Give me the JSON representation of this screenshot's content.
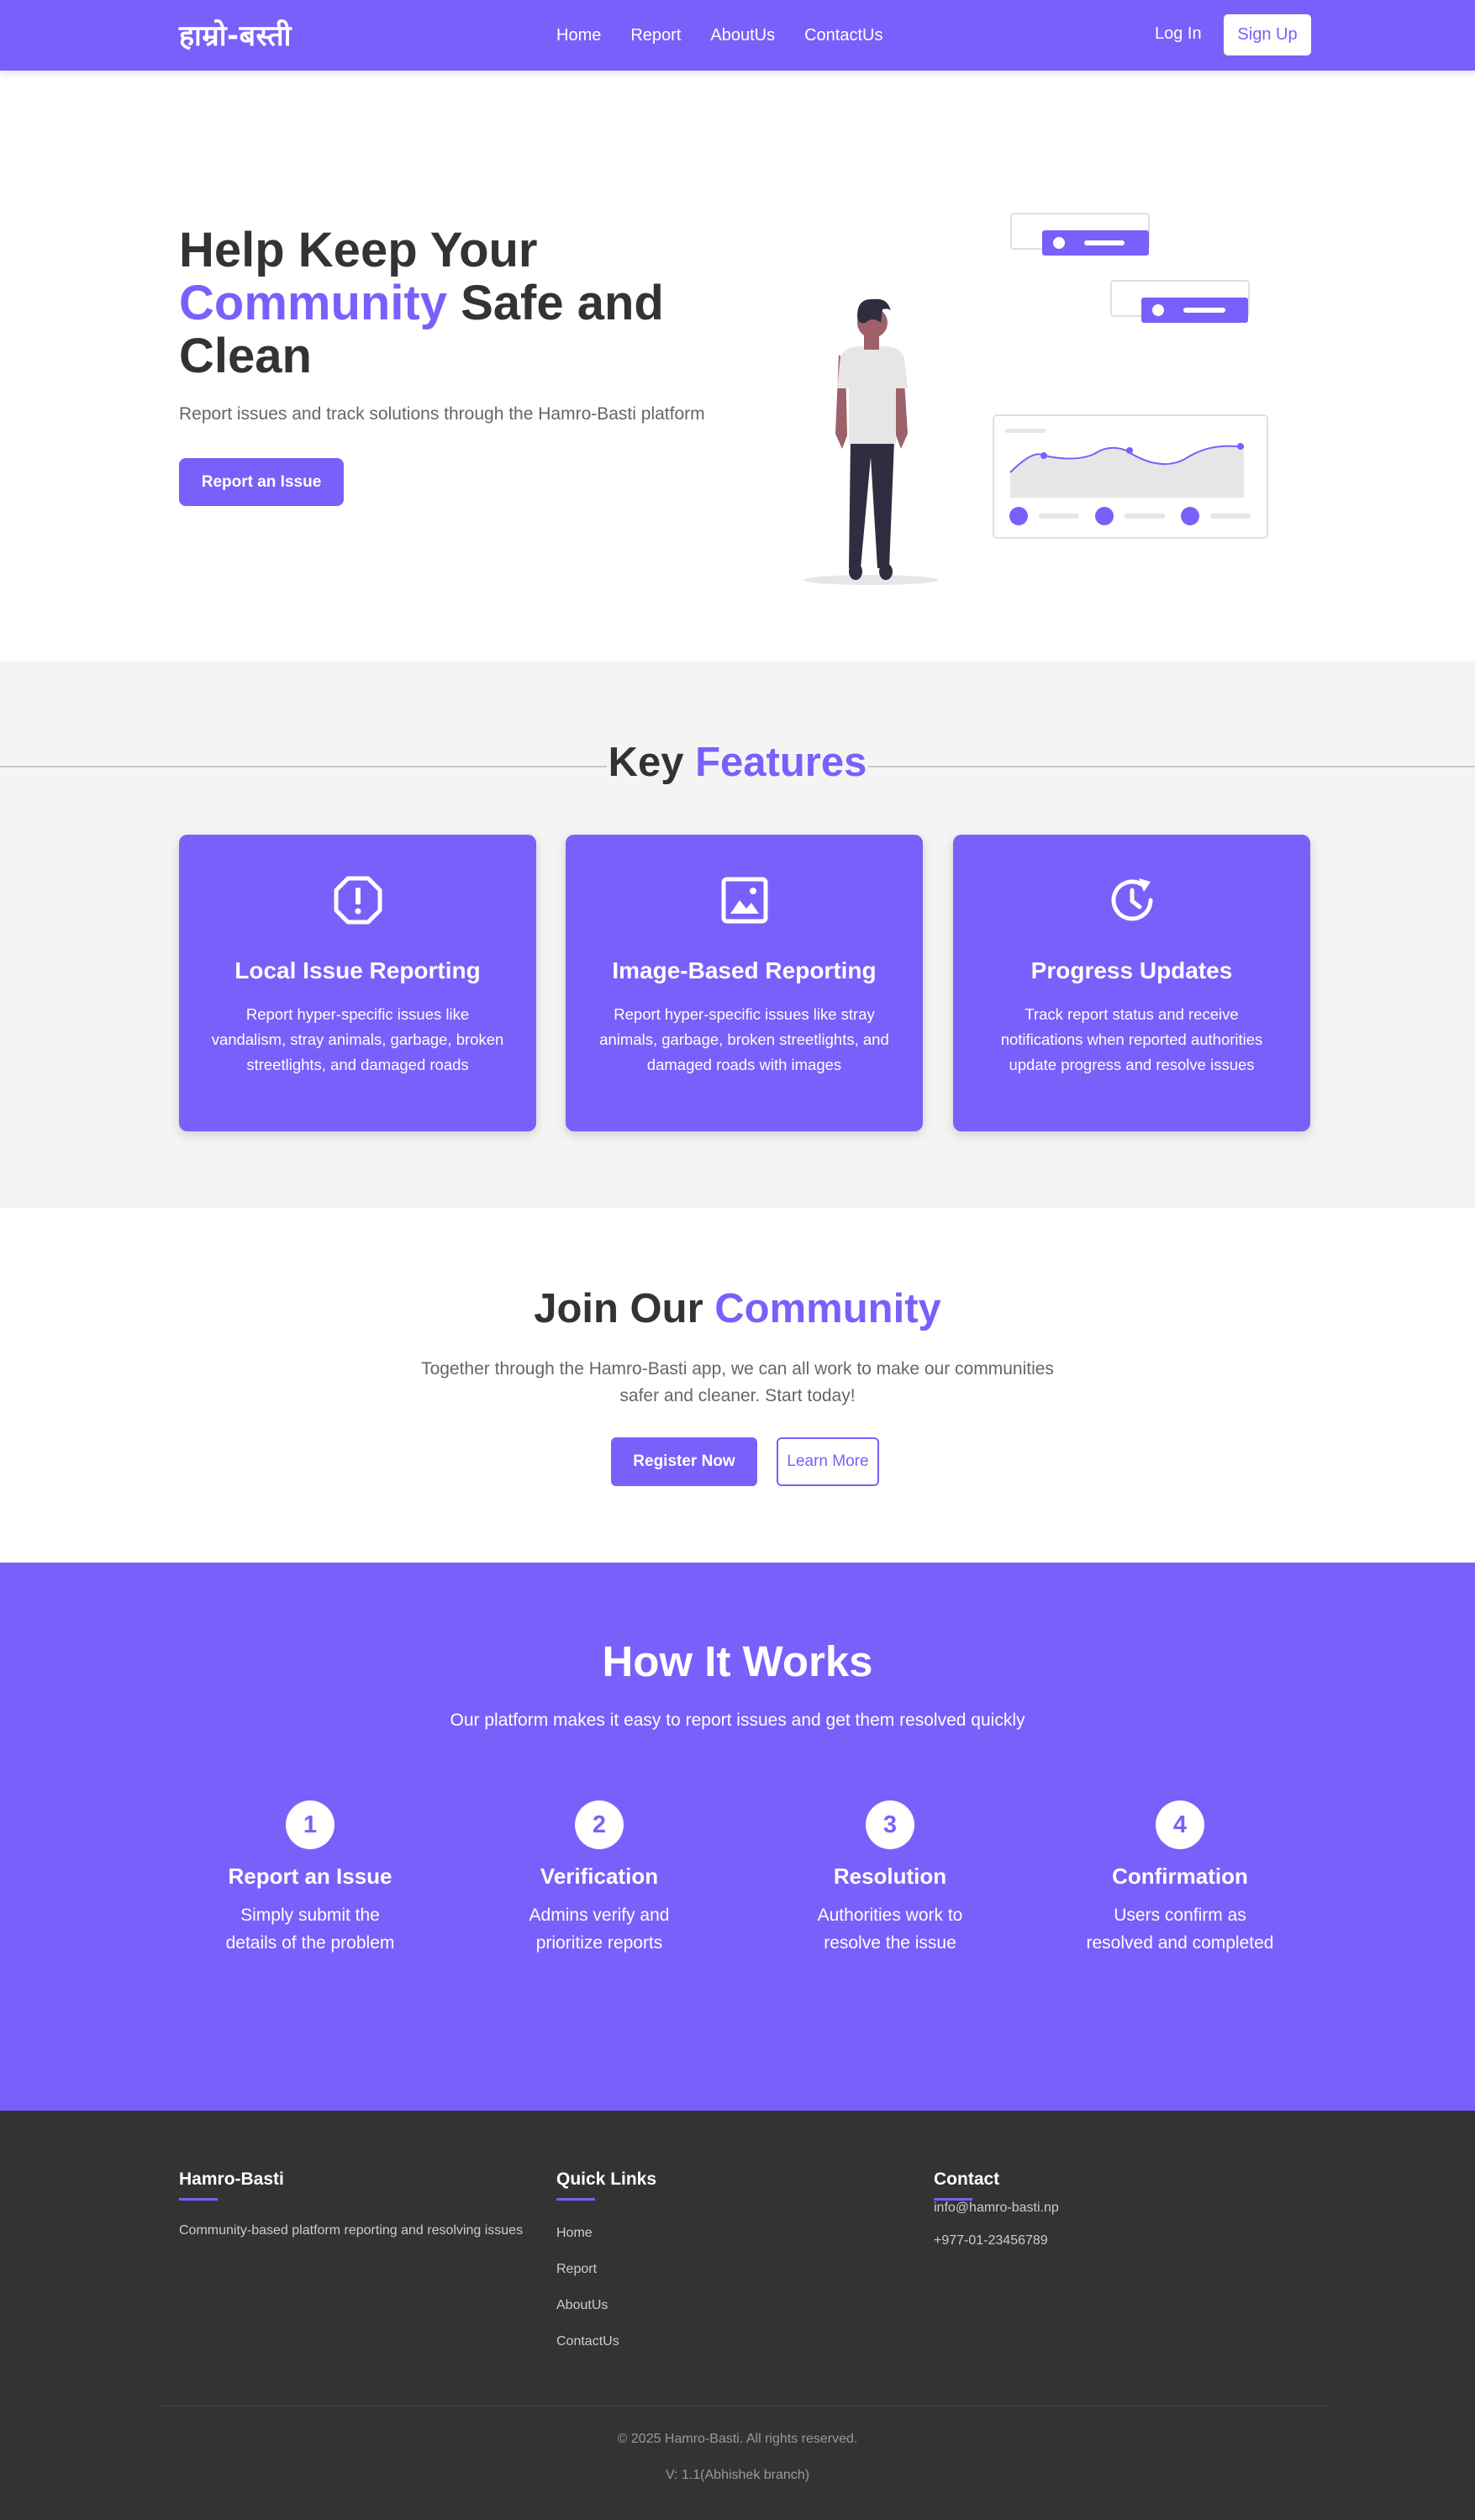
{
  "nav": {
    "logo": "हाम्रो-बस्ती",
    "links": [
      "Home",
      "Report",
      "AboutUs",
      "ContactUs"
    ],
    "login": "Log In",
    "signup": "Sign Up"
  },
  "hero": {
    "title_line1": "Help Keep Your",
    "title_highlight": "Community",
    "title_rest": " Safe and",
    "title_line3": "Clean",
    "subtitle": "Report issues and track solutions through the Hamro-Basti platform",
    "cta": "Report an Issue",
    "illustration": "person-with-dashboard-illustration"
  },
  "features": {
    "heading_plain": "Key ",
    "heading_highlight": "Features",
    "cards": [
      {
        "icon": "alert-octagon-icon",
        "title": "Local Issue Reporting",
        "desc": "Report hyper-specific issues like vandalism, stray animals, garbage, broken streetlights, and damaged roads"
      },
      {
        "icon": "image-icon",
        "title": "Image-Based Reporting",
        "desc": "Report hyper-specific issues like stray animals, garbage, broken streetlights, and damaged roads with images"
      },
      {
        "icon": "clock-refresh-icon",
        "title": "Progress Updates",
        "desc": "Track report status and receive notifications when reported authorities update progress and resolve issues"
      }
    ]
  },
  "join": {
    "heading_plain": "Join Our ",
    "heading_highlight": "Community",
    "text": "Together through the Hamro-Basti app, we can all work to make our communities safer and cleaner. Start today!",
    "register": "Register Now",
    "learn": "Learn More"
  },
  "how": {
    "heading": "How It Works",
    "subtitle": "Our platform makes it easy to report issues and get them resolved quickly",
    "steps": [
      {
        "num": "1",
        "title": "Report an Issue",
        "desc": "Simply submit the details of the problem"
      },
      {
        "num": "2",
        "title": "Verification",
        "desc": "Admins verify and prioritize reports"
      },
      {
        "num": "3",
        "title": "Resolution",
        "desc": "Authorities work to resolve the issue"
      },
      {
        "num": "4",
        "title": "Confirmation",
        "desc": "Users confirm as resolved and completed"
      }
    ]
  },
  "footer": {
    "brand": "Hamro-Basti",
    "brand_text": "Community-based platform reporting and resolving issues",
    "quick_title": "Quick Links",
    "quick_links": [
      "Home",
      "Report",
      "AboutUs",
      "ContactUs"
    ],
    "contact_title": "Contact",
    "email": "info@hamro-basti.np",
    "phone": "+977-01-23456789",
    "copyright": "© 2025 Hamro-Basti. All rights reserved.",
    "version": "V: 1.1(Abhishek branch)"
  },
  "colors": {
    "accent": "#7b5ffb",
    "dark": "#333333",
    "light_bg": "#f4f4f4"
  }
}
